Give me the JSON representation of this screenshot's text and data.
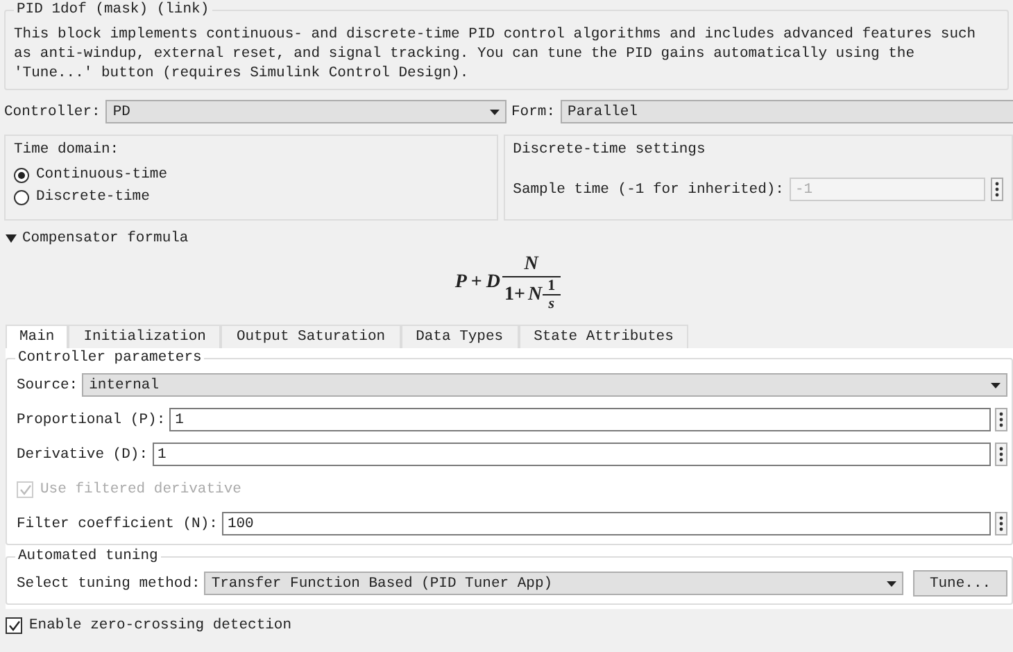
{
  "block": {
    "title": "PID 1dof (mask) (link)",
    "description": "This block implements continuous- and discrete-time PID control algorithms and includes advanced features such as anti-windup, external reset, and signal tracking. You can tune the PID gains automatically using the 'Tune...' button (requires Simulink Control Design)."
  },
  "controller": {
    "label": "Controller:",
    "value": "PD"
  },
  "form": {
    "label": "Form:",
    "value": "Parallel"
  },
  "time_domain": {
    "title": "Time domain:",
    "options": [
      {
        "label": "Continuous-time",
        "selected": true
      },
      {
        "label": "Discrete-time",
        "selected": false
      }
    ]
  },
  "discrete_settings": {
    "title": "Discrete-time settings",
    "sample_time": {
      "label": "Sample time (-1 for inherited):",
      "value": "-1",
      "disabled": true
    }
  },
  "compensator": {
    "title": "Compensator formula",
    "expanded": true,
    "formula": {
      "lead": "P",
      "plus": "+",
      "gain": "D",
      "numerator": "N",
      "denominator_lead": "1+",
      "denominator_var": "N",
      "inner_numerator": "1",
      "inner_denominator": "s"
    }
  },
  "tabs": [
    {
      "label": "Main",
      "selected": true
    },
    {
      "label": "Initialization",
      "selected": false
    },
    {
      "label": "Output Saturation",
      "selected": false
    },
    {
      "label": "Data Types",
      "selected": false
    },
    {
      "label": "State Attributes",
      "selected": false
    }
  ],
  "controller_parameters": {
    "title": "Controller parameters",
    "source": {
      "label": "Source:",
      "value": "internal"
    },
    "rows": [
      {
        "kind": "field",
        "label": "Proportional (P):",
        "value": "1"
      },
      {
        "kind": "field",
        "label": "Derivative (D):",
        "value": "1"
      },
      {
        "kind": "checkbox",
        "label": "Use filtered derivative",
        "checked": true,
        "disabled": true
      },
      {
        "kind": "field",
        "label": "Filter coefficient (N):",
        "value": "100"
      }
    ]
  },
  "automated_tuning": {
    "title": "Automated tuning",
    "method": {
      "label": "Select tuning method:",
      "value": "Transfer Function Based (PID Tuner App)"
    },
    "button": "Tune..."
  },
  "zero_crossing": {
    "label": "Enable zero-crossing detection",
    "checked": true
  }
}
